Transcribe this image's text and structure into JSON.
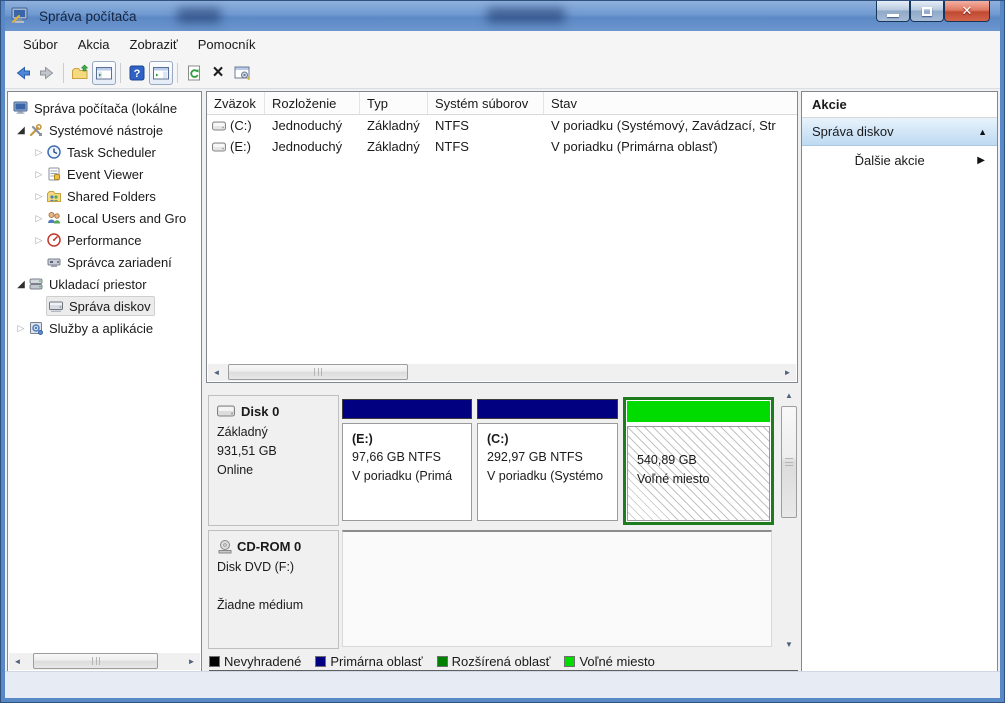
{
  "window": {
    "title": "Správa počítača"
  },
  "menu": {
    "items": [
      {
        "label": "Súbor"
      },
      {
        "label": "Akcia"
      },
      {
        "label": "Zobraziť"
      },
      {
        "label": "Pomocník"
      }
    ]
  },
  "toolbar": {
    "icons": [
      "back",
      "forward",
      "export",
      "show-console-tree",
      "help",
      "show-action-pane",
      "refresh",
      "delete",
      "properties"
    ]
  },
  "tree": {
    "items": [
      {
        "label": "Správa počítača (lokálne",
        "icon": "computer"
      },
      {
        "label": "Systémové nástroje",
        "icon": "tools",
        "expand": "expanded"
      },
      {
        "label": "Task Scheduler",
        "icon": "scheduler",
        "expand": "collapsed"
      },
      {
        "label": "Event Viewer",
        "icon": "event-viewer",
        "expand": "collapsed"
      },
      {
        "label": "Shared Folders",
        "icon": "shared-folders",
        "expand": "collapsed"
      },
      {
        "label": "Local Users and Gro",
        "icon": "users",
        "expand": "collapsed"
      },
      {
        "label": "Performance",
        "icon": "performance",
        "expand": "collapsed"
      },
      {
        "label": "Správca zariadení",
        "icon": "device-manager"
      },
      {
        "label": "Ukladací priestor",
        "icon": "storage",
        "expand": "expanded"
      },
      {
        "label": "Správa diskov",
        "icon": "disk-management",
        "selected": true
      },
      {
        "label": "Služby a aplikácie",
        "icon": "services",
        "expand": "collapsed"
      }
    ]
  },
  "volumes": {
    "columns": [
      "Zväzok",
      "Rozloženie",
      "Typ",
      "Systém súborov",
      "Stav"
    ],
    "rows": [
      {
        "volume": "(C:)",
        "layout": "Jednoduchý",
        "type": "Základný",
        "filesystem": "NTFS",
        "status": "V poriadku (Systémový, Zavádzací, Str"
      },
      {
        "volume": "(E:)",
        "layout": "Jednoduchý",
        "type": "Základný",
        "filesystem": "NTFS",
        "status": "V poriadku (Primárna oblasť)"
      }
    ]
  },
  "disk0": {
    "name": "Disk 0",
    "type": "Základný",
    "size": "931,51 GB",
    "status": "Online",
    "partitions": [
      {
        "name": "(E:)",
        "size_fs": "97,66 GB NTFS",
        "status": "V poriadku (Primá",
        "bar_color": "#000080"
      },
      {
        "name": "(C:)",
        "size_fs": "292,97 GB NTFS",
        "status": "V poriadku (Systémo",
        "bar_color": "#000080"
      },
      {
        "name": "",
        "size_fs": "540,89 GB",
        "status": "Voľné miesto",
        "bar_color": "#00dc00",
        "selected": true
      }
    ]
  },
  "cdrom": {
    "name": "CD-ROM 0",
    "media": "Disk DVD (F:)",
    "status": "Žiadne médium"
  },
  "legend": {
    "items": [
      {
        "label": "Nevyhradené",
        "color": "#000000"
      },
      {
        "label": "Primárna oblasť",
        "color": "#000080"
      },
      {
        "label": "Rozšírená oblasť",
        "color": "#008000"
      },
      {
        "label": "Voľné miesto",
        "color": "#00dc00"
      }
    ]
  },
  "actions": {
    "header": "Akcie",
    "group_label": "Správa diskov",
    "more_label": "Ďalšie akcie"
  },
  "colors": {
    "selection_border": "#1d7c1d",
    "primary_partition": "#000080",
    "free_space": "#00dc00",
    "titlebar": "#6f99d0"
  }
}
